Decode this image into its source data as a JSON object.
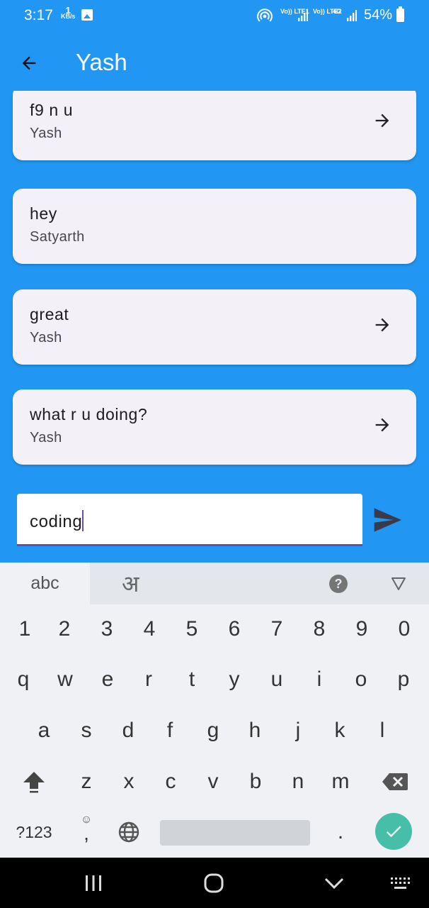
{
  "status_bar": {
    "time": "3:17",
    "data_speed_value": "1",
    "data_speed_unit": "KB/s",
    "sim1_label": "Vo)) LTE1",
    "sim2_label": "Vo)) LTE2",
    "network_type": "4G",
    "battery": "54%"
  },
  "app_bar": {
    "title": "Yash",
    "back_icon": "arrow-left-icon"
  },
  "messages": [
    {
      "text": "f9 n u",
      "sender": "Yash",
      "has_arrow": true
    },
    {
      "text": "hey",
      "sender": "Satyarth",
      "has_arrow": false
    },
    {
      "text": "great",
      "sender": "Yash",
      "has_arrow": true
    },
    {
      "text": "what r u doing?",
      "sender": "Yash",
      "has_arrow": true
    }
  ],
  "composer": {
    "value": "coding",
    "send_icon": "send-icon"
  },
  "keyboard": {
    "tab_abc": "abc",
    "tab_hindi": "अ",
    "help": "?",
    "number_row": [
      "1",
      "2",
      "3",
      "4",
      "5",
      "6",
      "7",
      "8",
      "9",
      "0"
    ],
    "row_q": [
      "q",
      "w",
      "e",
      "r",
      "t",
      "y",
      "u",
      "i",
      "o",
      "p"
    ],
    "row_a": [
      "a",
      "s",
      "d",
      "f",
      "g",
      "h",
      "j",
      "k",
      "l"
    ],
    "row_z": [
      "z",
      "x",
      "c",
      "v",
      "b",
      "n",
      "m"
    ],
    "symbols_key": "?123",
    "comma_key": ",",
    "emoji_hint": "☺",
    "period_key": "."
  },
  "colors": {
    "primary": "#2196F3",
    "card": "#F4F0F8",
    "input_underline": "#6750A4",
    "enter_key": "#47BFA8"
  }
}
